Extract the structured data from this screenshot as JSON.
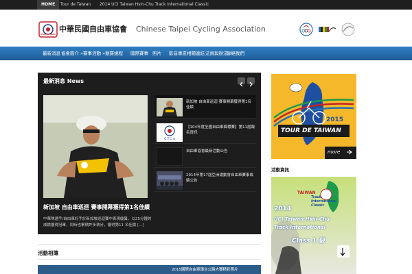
{
  "topbar": {
    "items": [
      "HOME",
      "Tour de Taiwan",
      "2014 UCI Taiwan Hsin-Chu Track International Classic"
    ]
  },
  "header": {
    "brand_cn": "中華民國自由車協會",
    "brand_en": "Chinese Taipei Cycling Association",
    "logo_label": "C.T.C.A"
  },
  "nav": {
    "items": [
      "最新消息",
      "協會簡介 »",
      "賽事活動 »",
      "競賽規程",
      "國際賽事",
      "照片",
      "影音專區",
      "相關連結",
      "法規與辦法",
      "聯絡我們"
    ]
  },
  "slider": {
    "title": "最新消息 News",
    "featured_caption": "新加坡 自由車巡迴 賽事開幕獲得第1名佳績",
    "featured_excerpt": "中華隊選手/自由車好手於新加坡巡迴賽中表現優異，以25分鐘的成績獲得冠軍，同時也累積許多積分，獲得第11 名佳績 [...]",
    "list": [
      {
        "text": "新加坡 自由車巡迴 賽事開幕獲得第1名佳績"
      },
      {
        "text": "【104年度全國自由車錦標賽】第11屆報名資訊"
      },
      {
        "text": "自由車協會最新活動公告"
      },
      {
        "text": "2014年第17屆亞洲運動會自由車賽事成績公告"
      }
    ]
  },
  "section": {
    "heading": "活動相簿",
    "bottom_card": "2015國際自由車環台公路大賽精彩照片"
  },
  "sidebar": {
    "heading": "活動資訊",
    "banner1": {
      "year": "2015",
      "title": "TOUR DE TAIWAN",
      "more": "more"
    },
    "banner2": {
      "line1": "TAIWAN",
      "line2": "Track International Classic",
      "year": "2014",
      "line3": "UCI Taiwan Hsin-Chu",
      "line4": "Track International",
      "line5": "Class 1 級"
    }
  },
  "colors": {
    "nav": "#2f7fc2",
    "slider_bg": "#1d1d1d",
    "banner_yellow": "#f5b82a"
  }
}
